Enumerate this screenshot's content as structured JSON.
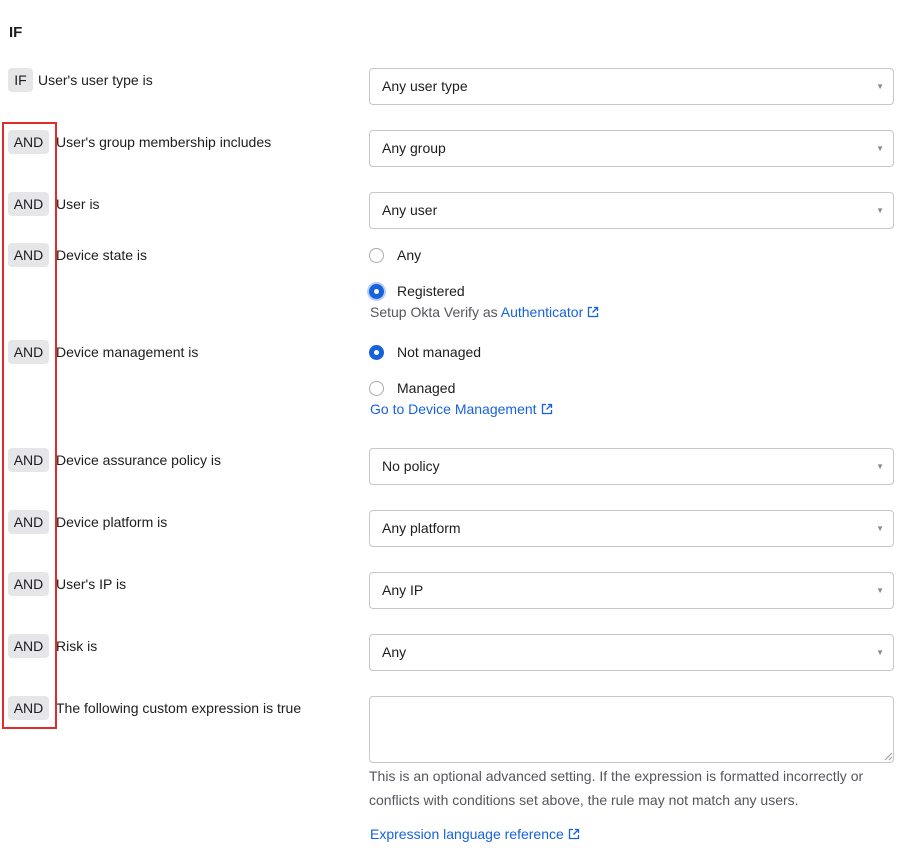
{
  "section": {
    "heading": "IF"
  },
  "conditions": {
    "user_type": {
      "badge": "IF",
      "label": "User's user type is",
      "value": "Any user type"
    },
    "group_membership": {
      "badge": "AND",
      "label": "User's group membership includes",
      "value": "Any group"
    },
    "user": {
      "badge": "AND",
      "label": "User is",
      "value": "Any user"
    },
    "device_state": {
      "badge": "AND",
      "label": "Device state is",
      "options": [
        {
          "label": "Any",
          "checked": false
        },
        {
          "label": "Registered",
          "checked": true
        }
      ],
      "hint_prefix": "Setup Okta Verify as",
      "link": "Authenticator"
    },
    "device_management": {
      "badge": "AND",
      "label": "Device management is",
      "options": [
        {
          "label": "Not managed",
          "checked": true
        },
        {
          "label": "Managed",
          "checked": false
        }
      ],
      "link": "Go to Device Management"
    },
    "device_assurance": {
      "badge": "AND",
      "label": "Device assurance policy is",
      "value": "No policy"
    },
    "device_platform": {
      "badge": "AND",
      "label": "Device platform is",
      "value": "Any platform"
    },
    "user_ip": {
      "badge": "AND",
      "label": "User's IP is",
      "value": "Any IP"
    },
    "risk": {
      "badge": "AND",
      "label": "Risk is",
      "value": "Any"
    },
    "custom_expression": {
      "badge": "AND",
      "label": "The following custom expression is true",
      "value": "",
      "help_text": "This is an optional advanced setting. If the expression is formatted incorrectly or conflicts with conditions set above, the rule may not match any users.",
      "link": "Expression language reference"
    }
  },
  "icons": {
    "dropdown": "caret-down-icon",
    "external": "external-link-icon"
  },
  "colors": {
    "accent": "#1662dd",
    "highlight": "#e22b2b",
    "badge_bg": "#e6e6e9"
  }
}
